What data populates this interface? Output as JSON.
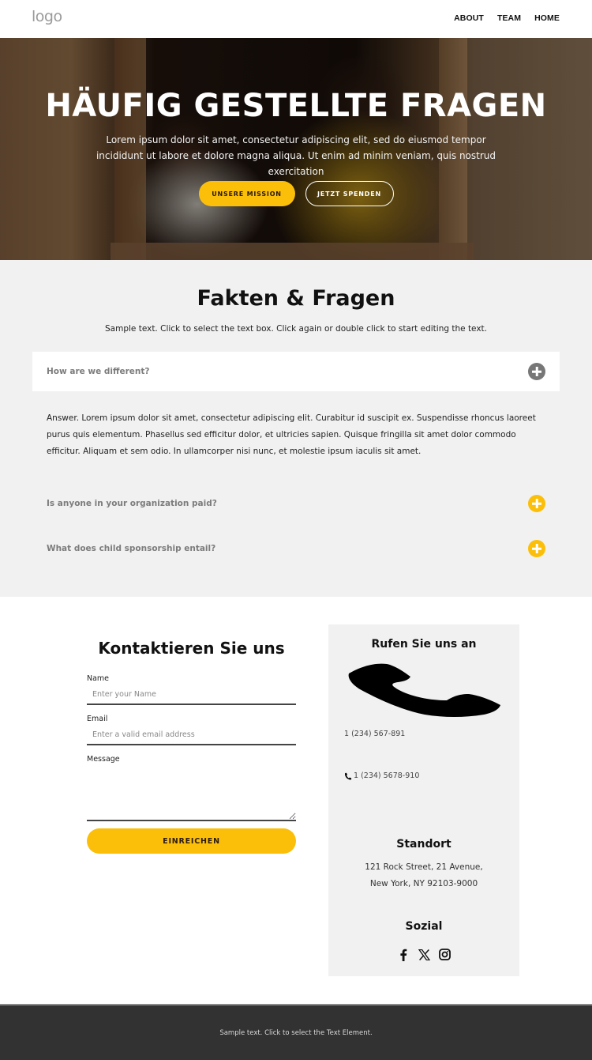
{
  "header": {
    "logo": "logo",
    "nav": [
      {
        "label": "ABOUT"
      },
      {
        "label": "TEAM"
      },
      {
        "label": "HOME"
      }
    ]
  },
  "hero": {
    "title": "HÄUFIG GESTELLTE FRAGEN",
    "subtitle": "Lorem ipsum dolor sit amet, consectetur adipiscing elit, sed do eiusmod tempor incididunt ut labore et dolore magna aliqua. Ut enim ad minim veniam, quis nostrud exercitation",
    "primary_button": "UNSERE MISSION",
    "secondary_button": "JETZT SPENDEN"
  },
  "faq": {
    "title": "Fakten & Fragen",
    "subtitle": "Sample text. Click to select the text box. Click again or double click to start editing the text.",
    "items": [
      {
        "question": "How are we different?",
        "expanded": true,
        "answer": "Answer. Lorem ipsum dolor sit amet, consectetur adipiscing elit. Curabitur id suscipit ex. Suspendisse rhoncus laoreet purus quis elementum. Phasellus sed efficitur dolor, et ultricies sapien. Quisque fringilla sit amet dolor commodo efficitur. Aliquam et sem odio. In ullamcorper nisi nunc, et molestie ipsum iaculis sit amet."
      },
      {
        "question": "Is anyone in your organization paid?",
        "expanded": false
      },
      {
        "question": "What does child sponsorship entail?",
        "expanded": false
      }
    ]
  },
  "contact": {
    "title": "Kontaktieren Sie uns",
    "fields": {
      "name": {
        "label": "Name",
        "placeholder": "Enter your Name",
        "value": ""
      },
      "email": {
        "label": "Email",
        "placeholder": "Enter a valid email address",
        "value": ""
      },
      "message": {
        "label": "Message",
        "value": ""
      }
    },
    "submit_label": "EINREICHEN"
  },
  "info": {
    "call_heading": "Rufen Sie uns an",
    "phone_1": "1 (234) 567-891",
    "phone_2": "1 (234) 5678-910",
    "location_heading": "Standort",
    "address_line_1": "121 Rock Street, 21 Avenue,",
    "address_line_2": "New York, NY 92103-9000",
    "social_heading": "Sozial",
    "social_icons": [
      "facebook-icon",
      "x-icon",
      "instagram-icon"
    ]
  },
  "footer": {
    "text": "Sample text. Click to select the Text Element."
  },
  "colors": {
    "accent": "#fbbf0a",
    "section_bg": "#f1f1f1",
    "footer_bg": "#323232",
    "expanded_toggle": "#777777"
  }
}
